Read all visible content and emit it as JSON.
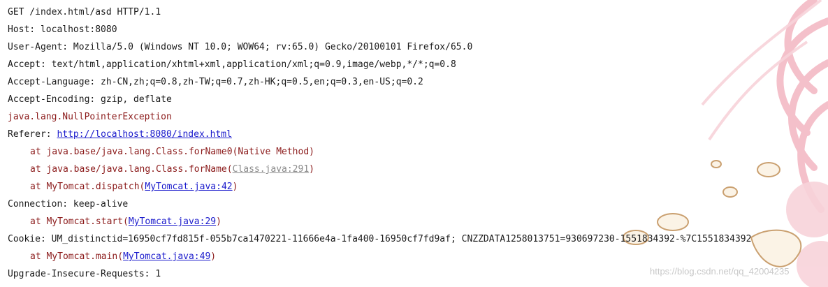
{
  "console": {
    "get": "GET /index.html/asd HTTP/1.1",
    "host": "Host: localhost:8080",
    "user_agent": "User-Agent: Mozilla/5.0 (Windows NT 10.0; WOW64; rv:65.0) Gecko/20100101 Firefox/65.0",
    "accept": "Accept: text/html,application/xhtml+xml,application/xml;q=0.9,image/webp,*/*;q=0.8",
    "accept_language": "Accept-Language: zh-CN,zh;q=0.8,zh-TW;q=0.7,zh-HK;q=0.5,en;q=0.3,en-US;q=0.2",
    "accept_encoding": "Accept-Encoding: gzip, deflate",
    "exception": "java.lang.NullPointerException",
    "referer_prefix": "Referer: ",
    "referer_url": "http://localhost:8080/index.html",
    "frame1": "at java.base/java.lang.Class.forName0(Native Method)",
    "frame2_prefix": "at java.base/java.lang.Class.forName(",
    "frame2_link": "Class.java:291",
    "frame3_prefix": "at MyTomcat.dispatch(",
    "frame3_link": "MyTomcat.java:42",
    "connection": "Connection: keep-alive",
    "frame4_prefix": "at MyTomcat.start(",
    "frame4_link": "MyTomcat.java:29",
    "cookie": "Cookie: UM_distinctid=16950cf7fd815f-055b7ca1470221-11666e4a-1fa400-16950cf7fd9af; CNZZDATA1258013751=930697230-1551834392-%7C1551834392",
    "frame5_prefix": "at MyTomcat.main(",
    "frame5_link": "MyTomcat.java:49",
    "upgrade": "Upgrade-Insecure-Requests: 1",
    "close_paren": ")"
  },
  "watermark": "https://blog.csdn.net/qq_42004235",
  "colors": {
    "stdout": "#1a1a1a",
    "stderr": "#8b1a1a",
    "link": "#1a1acc",
    "link_visited": "#8a8a8a",
    "ribbon": "#f3b6c1",
    "watermark": "#c8c8c8"
  },
  "icons": [
    "anime-ribbon-art",
    "melting-clock-icon"
  ]
}
